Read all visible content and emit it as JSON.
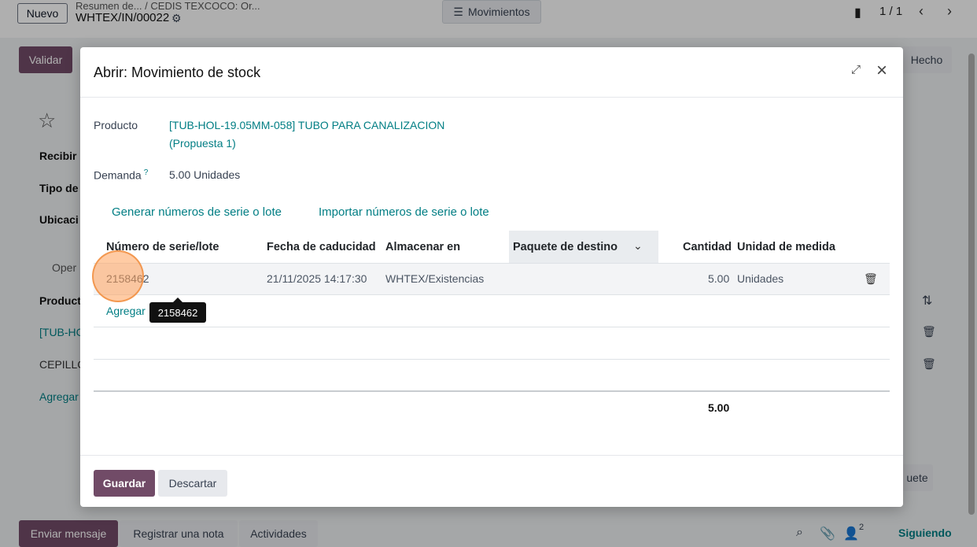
{
  "background": {
    "new_button": "Nuevo",
    "breadcrumb_top": "Resumen de... / CEDIS TEXCOCO: Or...",
    "record_ref": "WHTEX/IN/00022",
    "movements_button": "Movimientos",
    "pager": "1 / 1",
    "validate_button": "Validar",
    "done_status": "Hecho",
    "labels": [
      "Recibir",
      "Tipo de",
      "Ubicaci"
    ],
    "tab_ops": "Oper",
    "product_header": "Product",
    "row1": "[TUB-HC",
    "row2": "CEPILLC",
    "add_line": "Agregar",
    "package_button": "uete",
    "send_message": "Enviar mensaje",
    "log_note": "Registrar una nota",
    "activities": "Actividades",
    "followers_count": "2",
    "following": "Siguiendo"
  },
  "modal": {
    "title": "Abrir: Movimiento de stock",
    "product_label": "Producto",
    "product_value_line1": "[TUB-HOL-19.05MM-058] TUBO PARA CANALIZACION",
    "product_value_line2": "(Propuesta 1)",
    "demand_label": "Demanda",
    "demand_help": "?",
    "demand_value": "5.00 Unidades",
    "generate_link": "Generar números de serie o lote",
    "import_link": "Importar números de serie o lote",
    "columns": {
      "serial": "Número de serie/lote",
      "expiry": "Fecha de caducidad",
      "store_in": "Almacenar en",
      "dest_package": "Paquete de destino",
      "quantity": "Cantidad",
      "uom": "Unidad de medida"
    },
    "row": {
      "serial": "2158462",
      "expiry": "21/11/2025 14:17:30",
      "store_in": "WHTEX/Existencias",
      "quantity": "5.00",
      "uom": "Unidades"
    },
    "add_line": "Agregar",
    "total": "5.00",
    "save_button": "Guardar",
    "discard_button": "Descartar"
  },
  "tooltip": "2158462"
}
